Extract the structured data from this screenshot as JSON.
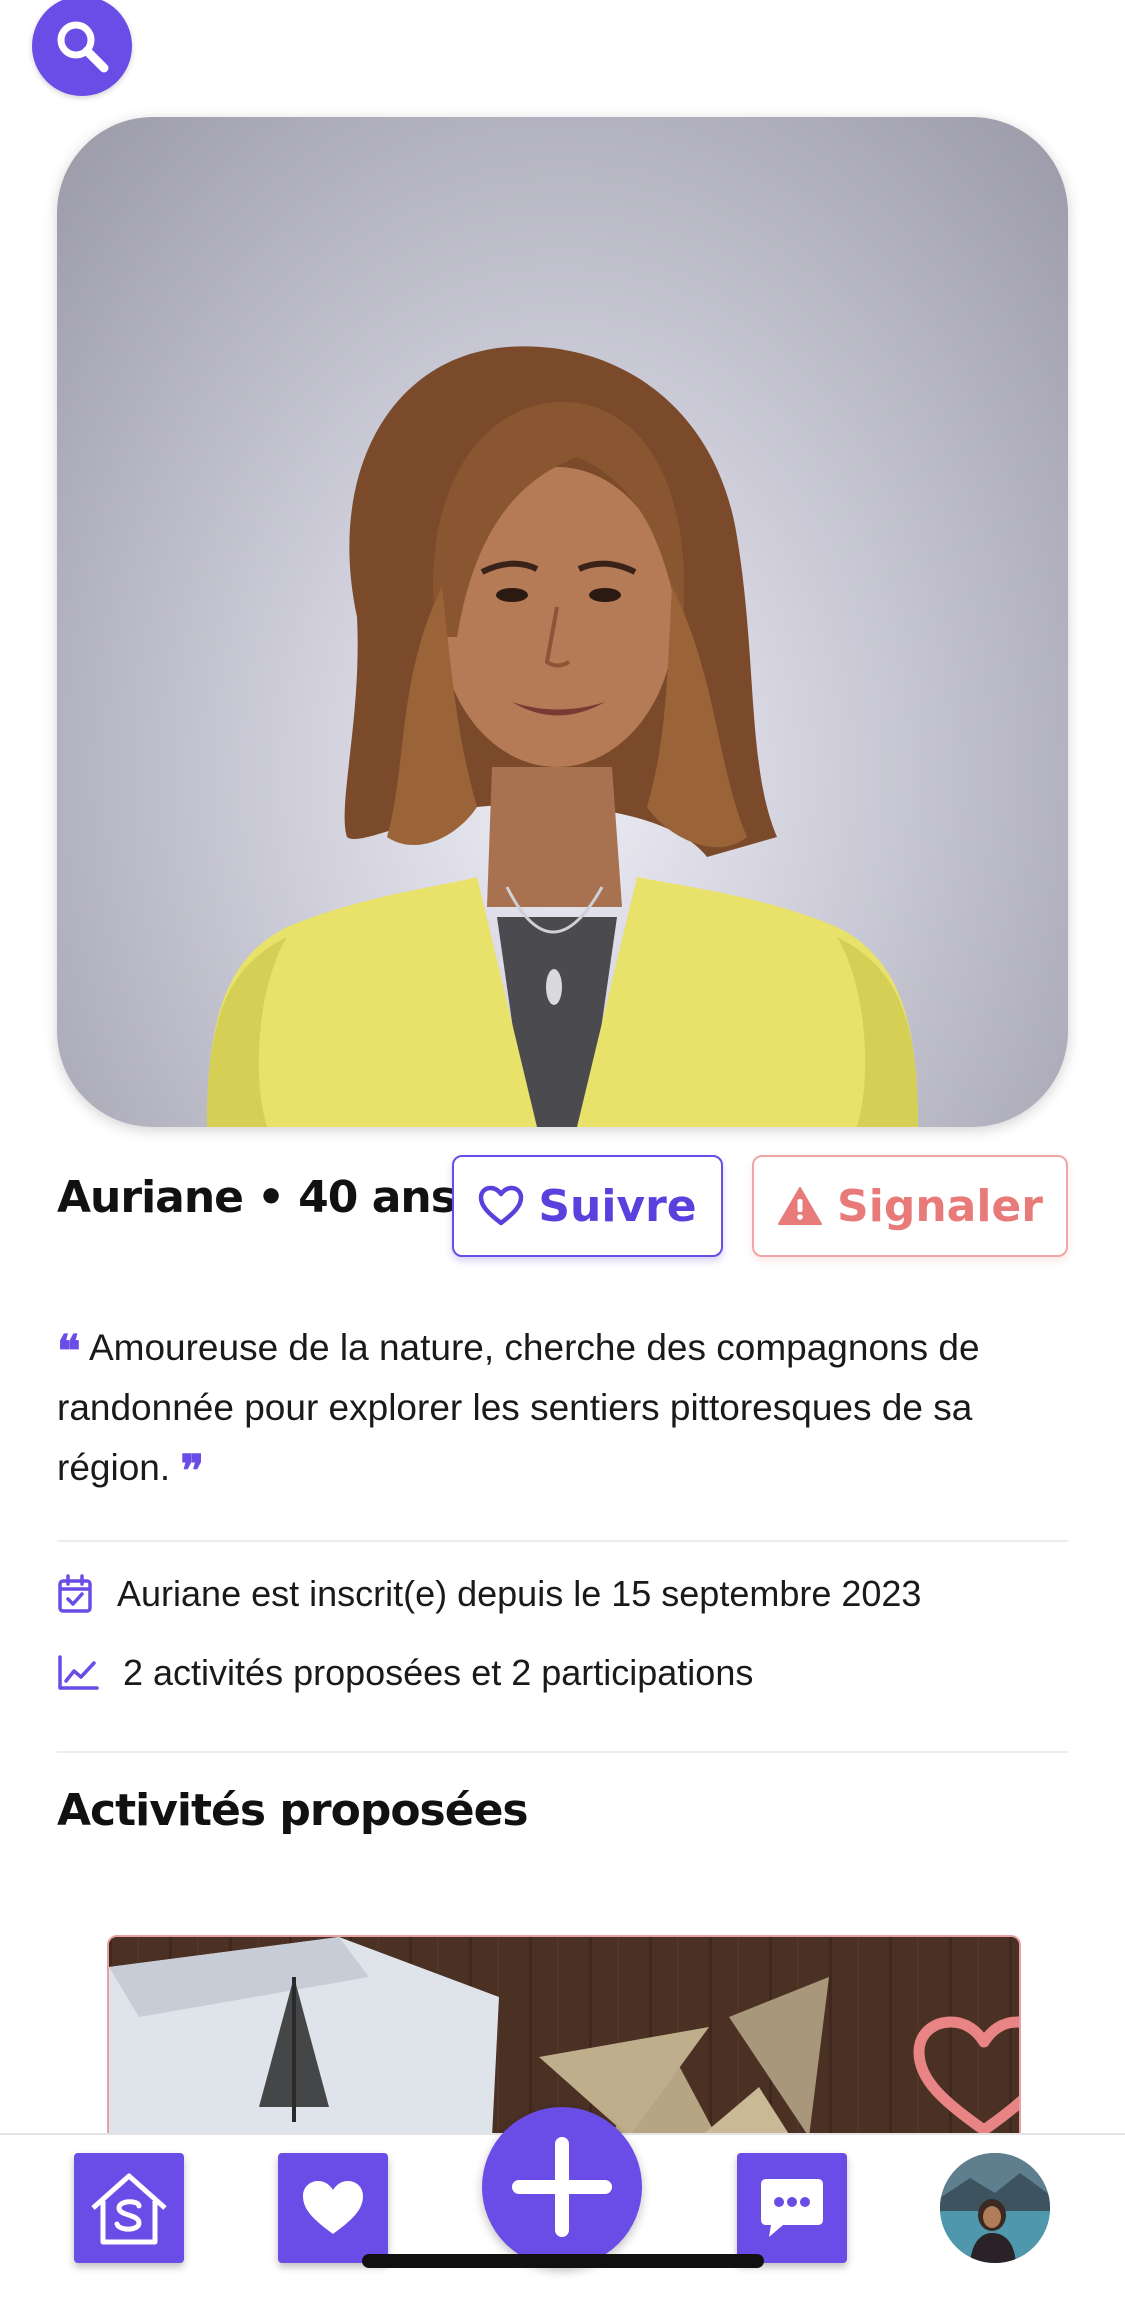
{
  "profile": {
    "name": "Auriane",
    "separator": "•",
    "age": "40 ans"
  },
  "actions": {
    "follow_label": "Suivre",
    "report_label": "Signaler"
  },
  "bio": {
    "text": "Amoureuse de la nature, cherche des compagnons de randonnée pour explorer les sentiers pittoresques de sa région.",
    "open_quote": "❝",
    "close_quote": "❞"
  },
  "stats": {
    "registered": "Auriane est inscrit(e) depuis le 15 septembre 2023",
    "activities": "2 activités proposées et 2 participations"
  },
  "sections": {
    "proposed_title": "Activités proposées"
  },
  "colors": {
    "accent": "#6a4ce6",
    "report": "#e87a7a"
  },
  "icons": {
    "search": "search-icon",
    "heart_outline": "heart-outline-icon",
    "warning": "warning-icon",
    "calendar": "calendar-check-icon",
    "chart": "chart-line-icon",
    "home": "home-icon",
    "heart": "heart-icon",
    "plus": "plus-icon",
    "chat": "chat-bubble-icon"
  }
}
